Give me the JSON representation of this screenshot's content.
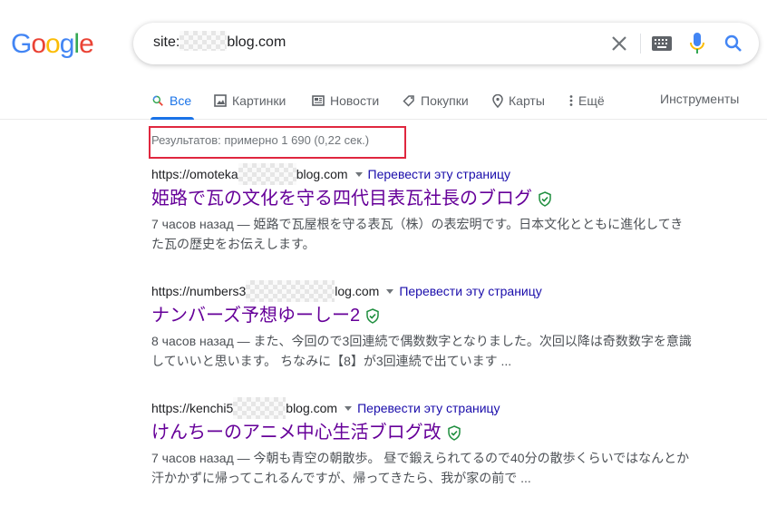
{
  "logo": {
    "letters": [
      "G",
      "o",
      "o",
      "g",
      "l",
      "e"
    ],
    "colors": [
      "#4285F4",
      "#EA4335",
      "#FBBC05",
      "#4285F4",
      "#34A853",
      "#EA4335"
    ]
  },
  "search": {
    "query_prefix": "site:",
    "query_suffix": "blog.com"
  },
  "tabs": [
    {
      "label": "Все",
      "icon": "search-icon"
    },
    {
      "label": "Картинки",
      "icon": "image-icon"
    },
    {
      "label": "Новости",
      "icon": "news-icon"
    },
    {
      "label": "Покупки",
      "icon": "tag-icon"
    },
    {
      "label": "Карты",
      "icon": "map-pin-icon"
    },
    {
      "label": "Ещё",
      "icon": "more-vert-icon"
    }
  ],
  "tools_label": "Инструменты",
  "stats": "Результатов: примерно 1 690 (0,22 сек.)",
  "results": [
    {
      "url_prefix": "https://omoteka",
      "url_suffix": "blog.com",
      "translate": "Перевести эту страницу",
      "title": "姫路で瓦の文化を守る四代目表瓦社長のブログ",
      "snippet": "7 часов назад — 姫路で瓦屋根を守る表瓦（株）の表宏明です。日本文化とともに進化してきた瓦の歴史をお伝えします。"
    },
    {
      "url_prefix": "https://numbers3",
      "url_suffix": "log.com",
      "translate": "Перевести эту страницу",
      "title": "ナンバーズ予想ゆーしー2",
      "snippet": "8 часов назад — また、今回ので3回連続で偶数数字となりました。次回以降は奇数数字を意識していいと思います。 ちなみに【8】が3回連続で出ています ..."
    },
    {
      "url_prefix": "https://kenchi5",
      "url_suffix": "blog.com",
      "translate": "Перевести эту страницу",
      "title": "けんちーのアニメ中心生活ブログ改",
      "snippet": "7 часов назад — 今朝も青空の朝散歩。 昼で鍛えられてるので40分の散歩くらいではなんとか汗かかずに帰ってこれるんですが、帰ってきたら、我が家の前で ..."
    }
  ],
  "colors": {
    "accent": "#1a73e8",
    "visited_title": "#660099",
    "link": "#1a0dab",
    "highlight_box": "#e0273f",
    "verified": "#1e8e3e"
  }
}
